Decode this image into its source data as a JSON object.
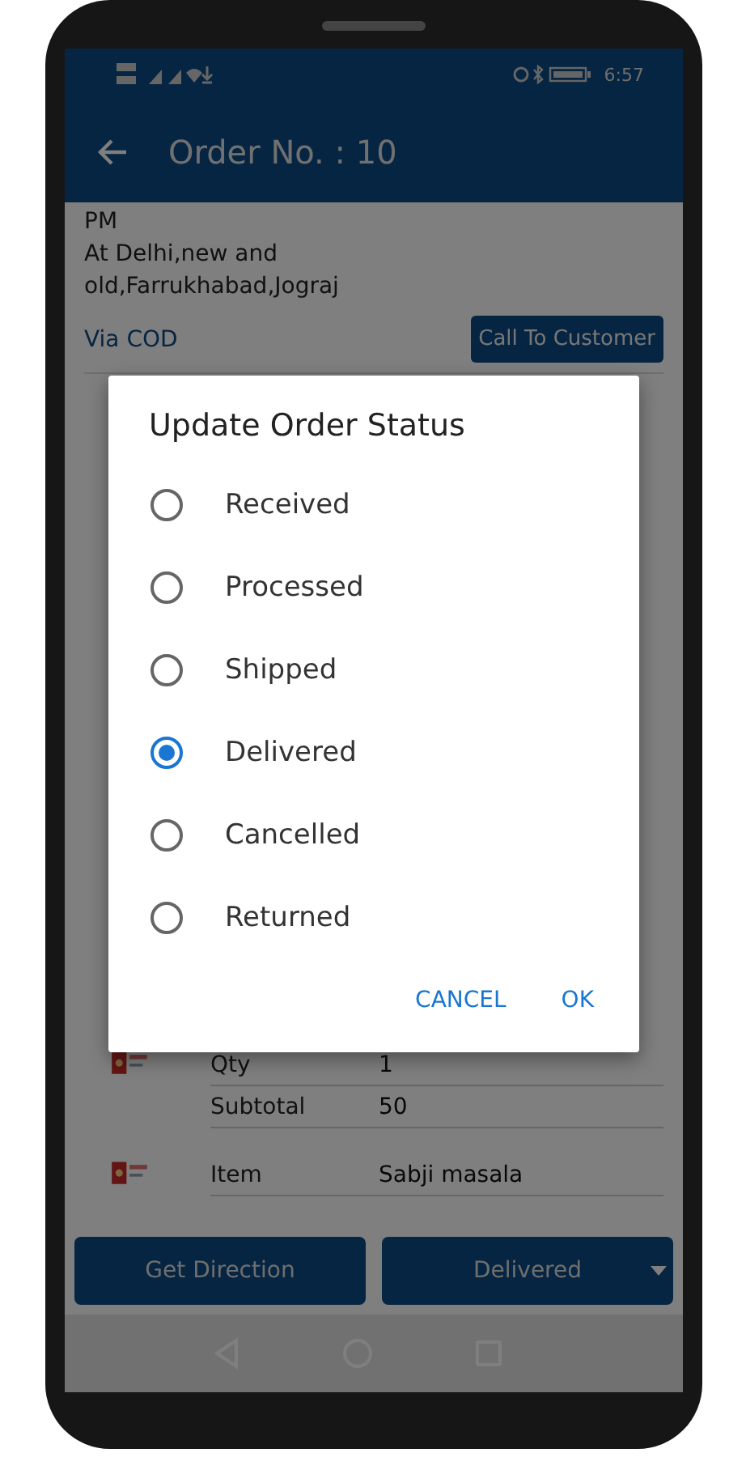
{
  "status_bar": {
    "time": "6:57"
  },
  "app_bar": {
    "title": "Order No. : 10"
  },
  "order": {
    "address_lines": [
      "PM",
      "At Delhi,new and",
      "old,Farrukhabad,Jograj"
    ],
    "payment": "Via COD",
    "call_button": "Call To Customer"
  },
  "items": [
    {
      "kind": "picture",
      "rows": [
        {
          "label": "Qty",
          "value": "1"
        },
        {
          "label": "Subtotal",
          "value": "50"
        }
      ]
    },
    {
      "kind": "picture",
      "rows": [
        {
          "label": "Item",
          "value": "Sabji masala"
        }
      ]
    }
  ],
  "bottom_bar": {
    "direction_button": "Get Direction",
    "status_dropdown": "Delivered"
  },
  "dialog": {
    "title": "Update Order Status",
    "options": [
      {
        "label": "Received",
        "selected": false
      },
      {
        "label": "Processed",
        "selected": false
      },
      {
        "label": "Shipped",
        "selected": false
      },
      {
        "label": "Delivered",
        "selected": true
      },
      {
        "label": "Cancelled",
        "selected": false
      },
      {
        "label": "Returned",
        "selected": false
      }
    ],
    "buttons": [
      "CANCEL",
      "OK"
    ]
  }
}
